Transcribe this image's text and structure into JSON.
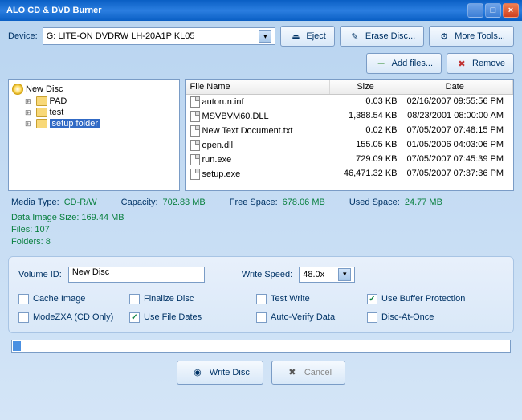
{
  "window": {
    "title": "ALO CD & DVD Burner"
  },
  "toolbar": {
    "device_label": "Device:",
    "device_value": "G: LITE-ON DVDRW LH-20A1P KL05",
    "eject": "Eject",
    "erase": "Erase Disc...",
    "more": "More Tools..."
  },
  "filebar": {
    "add": "Add files...",
    "remove": "Remove"
  },
  "tree": {
    "root": "New Disc",
    "items": [
      "PAD",
      "test",
      "setup folder"
    ]
  },
  "columns": {
    "name": "File Name",
    "size": "Size",
    "date": "Date"
  },
  "files": [
    {
      "name": "autorun.inf",
      "size": "0.03 KB",
      "date": "02/16/2007 09:55:56 PM"
    },
    {
      "name": "MSVBVM60.DLL",
      "size": "1,388.54 KB",
      "date": "08/23/2001 08:00:00 AM"
    },
    {
      "name": "New Text Document.txt",
      "size": "0.02 KB",
      "date": "07/05/2007 07:48:15 PM"
    },
    {
      "name": "open.dll",
      "size": "155.05 KB",
      "date": "01/05/2006 04:03:06 PM"
    },
    {
      "name": "run.exe",
      "size": "729.09 KB",
      "date": "07/05/2007 07:45:39 PM"
    },
    {
      "name": "setup.exe",
      "size": "46,471.32 KB",
      "date": "07/05/2007 07:37:36 PM"
    }
  ],
  "stats": {
    "media_type_label": "Media Type:",
    "media_type": "CD-R/W",
    "capacity_label": "Capacity:",
    "capacity": "702.83 MB",
    "free_label": "Free Space:",
    "free": "678.06 MB",
    "used_label": "Used Space:",
    "used": "24.77 MB",
    "image_size": "Data Image Size: 169.44 MB",
    "files_count": "Files: 107",
    "folders_count": "Folders: 8"
  },
  "options": {
    "volume_label": "Volume ID:",
    "volume_value": "New Disc",
    "speed_label": "Write Speed:",
    "speed_value": "48.0x",
    "checks": [
      {
        "label": "Cache Image",
        "checked": false
      },
      {
        "label": "Finalize Disc",
        "checked": false
      },
      {
        "label": "Test Write",
        "checked": false
      },
      {
        "label": "Use Buffer Protection",
        "checked": true
      },
      {
        "label": "ModeZXA (CD Only)",
        "checked": false
      },
      {
        "label": "Use File Dates",
        "checked": true
      },
      {
        "label": "Auto-Verify Data",
        "checked": false
      },
      {
        "label": "Disc-At-Once",
        "checked": false
      }
    ]
  },
  "buttons": {
    "write": "Write Disc",
    "cancel": "Cancel"
  }
}
